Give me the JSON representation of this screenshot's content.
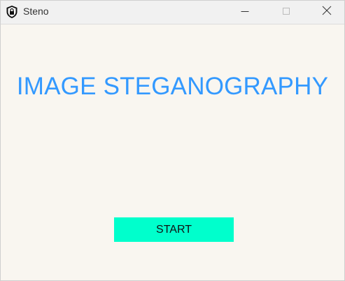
{
  "window": {
    "title": "Steno"
  },
  "main": {
    "heading": "IMAGE STEGANOGRAPHY",
    "start_label": "START"
  },
  "colors": {
    "heading": "#3399ff",
    "start_button": "#00ffcc",
    "background": "#f9f6f0"
  },
  "icons": {
    "app": "shield-lock-icon",
    "minimize": "minimize-icon",
    "maximize": "maximize-icon",
    "close": "close-icon"
  }
}
